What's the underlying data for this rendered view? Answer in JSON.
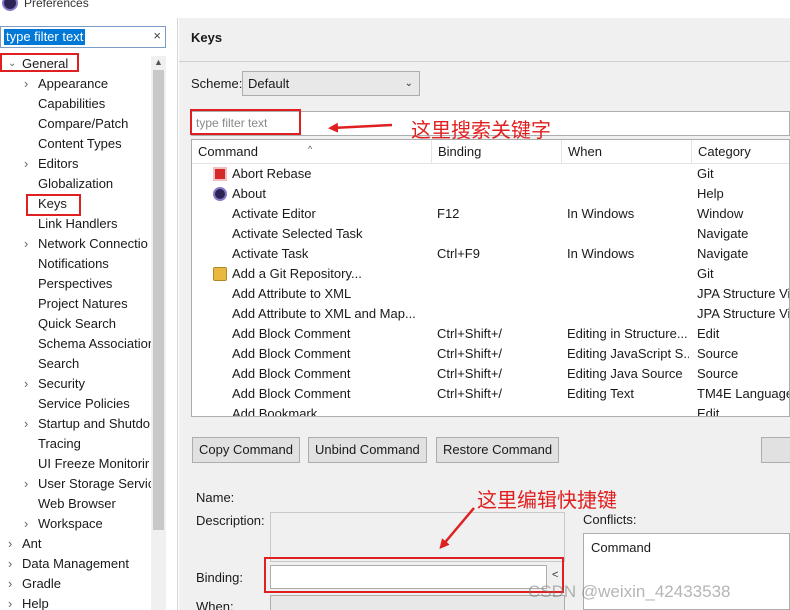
{
  "window": {
    "title": "Preferences"
  },
  "left": {
    "filter": {
      "value": "type filter text",
      "clear_glyph": "×"
    },
    "tree": [
      {
        "label": "General",
        "level": 0,
        "state": "expanded"
      },
      {
        "label": "Appearance",
        "level": 1,
        "state": "collapsed"
      },
      {
        "label": "Capabilities",
        "level": 1,
        "state": "leaf"
      },
      {
        "label": "Compare/Patch",
        "level": 1,
        "state": "leaf"
      },
      {
        "label": "Content Types",
        "level": 1,
        "state": "leaf"
      },
      {
        "label": "Editors",
        "level": 1,
        "state": "collapsed"
      },
      {
        "label": "Globalization",
        "level": 1,
        "state": "leaf"
      },
      {
        "label": "Keys",
        "level": 1,
        "state": "leaf",
        "selected": true
      },
      {
        "label": "Link Handlers",
        "level": 1,
        "state": "leaf"
      },
      {
        "label": "Network Connectio",
        "level": 1,
        "state": "collapsed"
      },
      {
        "label": "Notifications",
        "level": 1,
        "state": "leaf"
      },
      {
        "label": "Perspectives",
        "level": 1,
        "state": "leaf"
      },
      {
        "label": "Project Natures",
        "level": 1,
        "state": "leaf"
      },
      {
        "label": "Quick Search",
        "level": 1,
        "state": "leaf"
      },
      {
        "label": "Schema Associatior",
        "level": 1,
        "state": "leaf"
      },
      {
        "label": "Search",
        "level": 1,
        "state": "leaf"
      },
      {
        "label": "Security",
        "level": 1,
        "state": "collapsed"
      },
      {
        "label": "Service Policies",
        "level": 1,
        "state": "leaf"
      },
      {
        "label": "Startup and Shutdo",
        "level": 1,
        "state": "collapsed"
      },
      {
        "label": "Tracing",
        "level": 1,
        "state": "leaf"
      },
      {
        "label": "UI Freeze Monitorir",
        "level": 1,
        "state": "leaf"
      },
      {
        "label": "User Storage Servic",
        "level": 1,
        "state": "collapsed"
      },
      {
        "label": "Web Browser",
        "level": 1,
        "state": "leaf"
      },
      {
        "label": "Workspace",
        "level": 1,
        "state": "collapsed"
      },
      {
        "label": "Ant",
        "level": 0,
        "state": "collapsed"
      },
      {
        "label": "Data Management",
        "level": 0,
        "state": "collapsed"
      },
      {
        "label": "Gradle",
        "level": 0,
        "state": "collapsed"
      },
      {
        "label": "Help",
        "level": 0,
        "state": "collapsed"
      }
    ]
  },
  "keys": {
    "title": "Keys",
    "scheme_label": "Scheme:",
    "scheme_value": "Default",
    "filter_placeholder": "type filter text",
    "columns": [
      "Command",
      "Binding",
      "When",
      "Category"
    ],
    "rows": [
      {
        "icon": "stop-icon",
        "command": "Abort Rebase",
        "binding": "",
        "when": "",
        "category": "Git"
      },
      {
        "icon": "about-icon",
        "command": "About",
        "binding": "",
        "when": "",
        "category": "Help"
      },
      {
        "icon": "",
        "command": "Activate Editor",
        "binding": "F12",
        "when": "In Windows",
        "category": "Window"
      },
      {
        "icon": "",
        "command": "Activate Selected Task",
        "binding": "",
        "when": "",
        "category": "Navigate"
      },
      {
        "icon": "",
        "command": "Activate Task",
        "binding": "Ctrl+F9",
        "when": "In Windows",
        "category": "Navigate"
      },
      {
        "icon": "folder-icon",
        "command": "Add a Git Repository...",
        "binding": "",
        "when": "",
        "category": "Git"
      },
      {
        "icon": "",
        "command": "Add Attribute to XML",
        "binding": "",
        "when": "",
        "category": "JPA Structure Vie"
      },
      {
        "icon": "",
        "command": "Add Attribute to XML and Map...",
        "binding": "",
        "when": "",
        "category": "JPA Structure Vie"
      },
      {
        "icon": "",
        "command": "Add Block Comment",
        "binding": "Ctrl+Shift+/",
        "when": "Editing in Structure...",
        "category": "Edit"
      },
      {
        "icon": "",
        "command": "Add Block Comment",
        "binding": "Ctrl+Shift+/",
        "when": "Editing JavaScript S...",
        "category": "Source"
      },
      {
        "icon": "",
        "command": "Add Block Comment",
        "binding": "Ctrl+Shift+/",
        "when": "Editing Java Source",
        "category": "Source"
      },
      {
        "icon": "",
        "command": "Add Block Comment",
        "binding": "Ctrl+Shift+/",
        "when": "Editing Text",
        "category": "TM4E Language"
      },
      {
        "icon": "",
        "command": "Add Bookmark",
        "binding": "",
        "when": "",
        "category": "Edit"
      }
    ],
    "buttons": {
      "copy": "Copy Command",
      "unbind": "Unbind Command",
      "restore": "Restore Command"
    },
    "details": {
      "name_label": "Name:",
      "description_label": "Description:",
      "binding_label": "Binding:",
      "binding_value": "",
      "when_label": "When:",
      "conflicts_label": "Conflicts:",
      "conflicts_column": "Command"
    }
  },
  "annotations": {
    "search_note": "这里搜索关键字",
    "edit_note": "这里编辑快捷键",
    "watermark": "CSDN @weixin_42433538",
    "color": "#e02020"
  }
}
